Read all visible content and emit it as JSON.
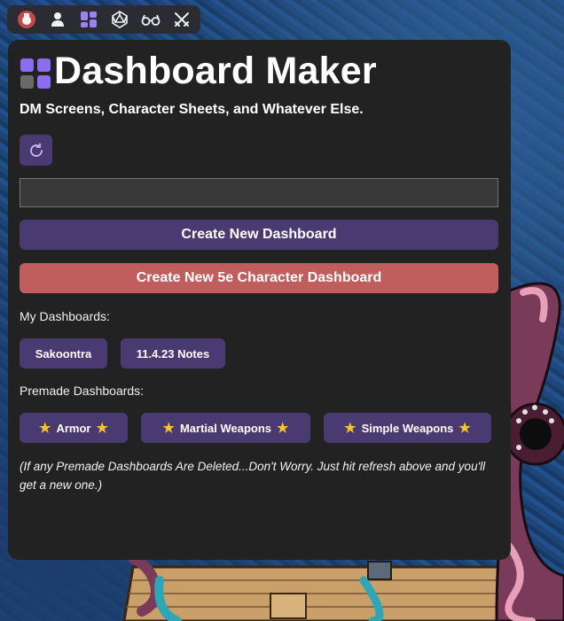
{
  "toolbar": {
    "icons": [
      "dungeon-master-icon",
      "user-icon",
      "dashboard-grid-icon",
      "d20-dice-icon",
      "glasses-icon",
      "crossed-swords-icon"
    ]
  },
  "header": {
    "title": "Dashboard Maker",
    "subtitle": "DM Screens, Character Sheets, and Whatever Else."
  },
  "controls": {
    "refresh_icon": "refresh-icon",
    "input_value": "",
    "create_new_label": "Create New Dashboard",
    "create_5e_label": "Create New 5e Character Dashboard"
  },
  "my_dashboards": {
    "label": "My Dashboards:",
    "items": [
      "Sakoontra",
      "11.4.23 Notes"
    ]
  },
  "premade": {
    "label": "Premade Dashboards:",
    "items": [
      "Armor",
      "Martial Weapons",
      "Simple Weapons"
    ]
  },
  "note": "(If any Premade Dashboards Are Deleted...Don't Worry. Just hit refresh above and you'll get a new one.)",
  "colors": {
    "panel": "#222222",
    "purple": "#4a3a72",
    "red": "#c05d5d",
    "accent": "#8b6df2",
    "star": "#f5c42c"
  }
}
